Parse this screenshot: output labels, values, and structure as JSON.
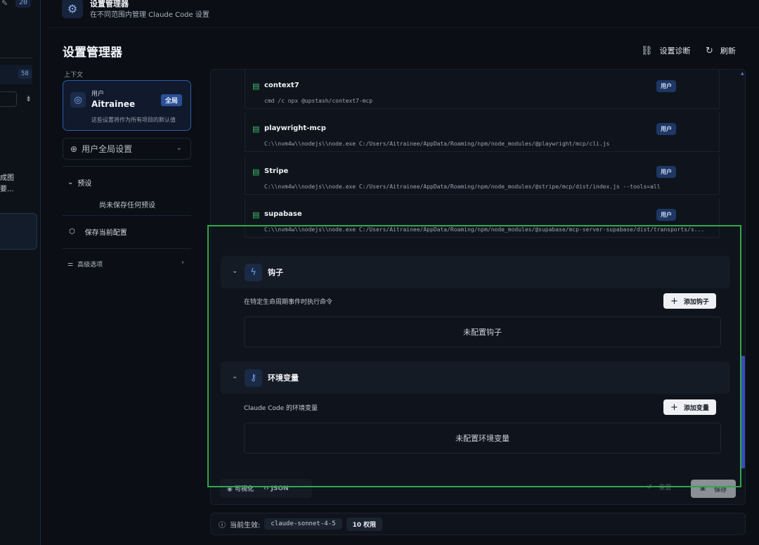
{
  "sidebar_sliver": {
    "badge_top": "20",
    "badge_row": "58",
    "text_line1": "成图",
    "text_line2": "要..."
  },
  "header": {
    "title": "设置管理器",
    "subtitle": "在不同范围内管理 Claude Code 设置"
  },
  "page": {
    "title": "设置管理器",
    "diagnostics_label": "设置诊断",
    "refresh_label": "刷新"
  },
  "left_panel": {
    "context_label": "上下文",
    "user_card": {
      "label": "用户",
      "name": "Aitrainee",
      "badge": "全局",
      "description": "这些设置将作为所有项目的默认值"
    },
    "scope_select": "用户全局设置",
    "presets_label": "预设",
    "no_presets": "尚未保存任何预设",
    "save_config": "保存当前配置",
    "advanced": "高级选项"
  },
  "mcp_servers": [
    {
      "name": "context7",
      "command": "cmd /c npx @upstash/context7-mcp",
      "scope": "用户"
    },
    {
      "name": "playwright-mcp",
      "command": "C:\\\\nvm4w\\\\nodejs\\\\node.exe C:/Users/Aitrainee/AppData/Roaming/npm/node_modules/@playwright/mcp/cli.js",
      "scope": "用户"
    },
    {
      "name": "Stripe",
      "command": "C:\\\\nvm4w\\\\nodejs\\\\node.exe C:/Users/Aitrainee/AppData/Roaming/npm/node_modules/@stripe/mcp/dist/index.js --tools=all",
      "scope": "用户"
    },
    {
      "name": "supabase",
      "command": "C:\\\\nvm4w\\\\nodejs\\\\node.exe C:/Users/Aitrainee/AppData/Roaming/npm/node_modules/@supabase/mcp-server-supabase/dist/transports/s...",
      "scope": "用户"
    }
  ],
  "hooks": {
    "title": "钩子",
    "description": "在特定生命周期事件时执行命令",
    "add_label": "添加钩子",
    "empty": "未配置钩子"
  },
  "env": {
    "title": "环境变量",
    "description": "Claude Code 的环境变量",
    "add_label": "添加变量",
    "empty": "未配置环境变量"
  },
  "footer": {
    "visual_tab": "可视化",
    "json_tab": "JSON",
    "reset_label": "重置",
    "save_label": "保存"
  },
  "status": {
    "label": "当前生效:",
    "model": "claude-sonnet-4-5",
    "permissions": "10 权限"
  },
  "colors": {
    "accent": "#2c5aa8",
    "server_icon": "#3fbf6a",
    "highlight": "#2fa84a"
  }
}
